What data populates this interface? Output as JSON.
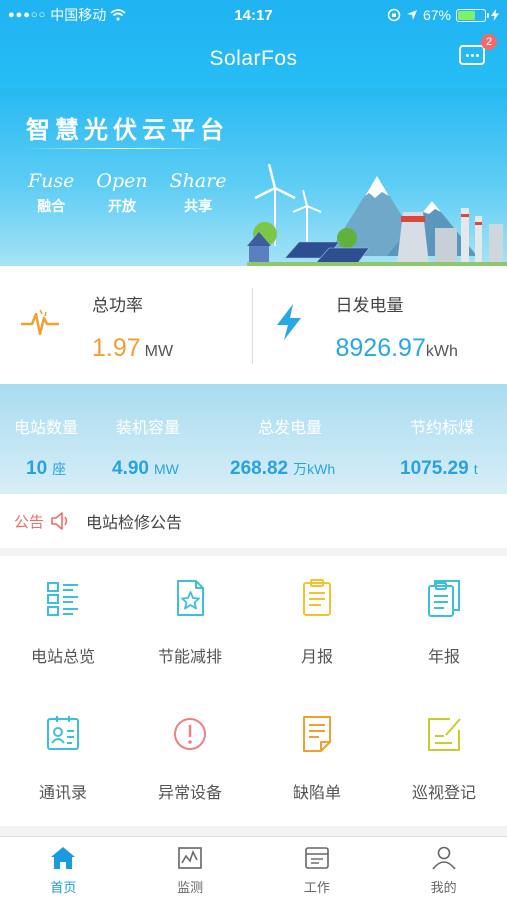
{
  "status_bar": {
    "signal": "●●●○○",
    "carrier": "中国移动",
    "time": "14:17",
    "battery": "67%",
    "battery_level": 0.67
  },
  "header": {
    "title": "SolarFos",
    "message_badge": "2"
  },
  "banner": {
    "slogan": "智慧光伏云平台",
    "words": [
      {
        "en": "Fuse",
        "cn": "融合"
      },
      {
        "en": "Open",
        "cn": "开放"
      },
      {
        "en": "Share",
        "cn": "共享"
      }
    ]
  },
  "power": {
    "total_label": "总功率",
    "total_value": "1.97",
    "total_unit": "MW",
    "daily_label": "日发电量",
    "daily_value": "8926.97",
    "daily_unit": "kWh"
  },
  "stats": [
    {
      "label": "电站数量",
      "value": "10",
      "unit": "座"
    },
    {
      "label": "装机容量",
      "value": "4.90",
      "unit": "MW"
    },
    {
      "label": "总发电量",
      "value": "268.82",
      "unit": "万kWh"
    },
    {
      "label": "节约标煤",
      "value": "1075.29",
      "unit": "t"
    }
  ],
  "notice": {
    "tag": "公告",
    "text": "电站检修公告"
  },
  "grid": [
    {
      "label": "电站总览",
      "icon": "station-overview-icon",
      "color": "#3cc0d8"
    },
    {
      "label": "节能减排",
      "icon": "energy-saving-icon",
      "color": "#3cc0d8"
    },
    {
      "label": "月报",
      "icon": "monthly-report-icon",
      "color": "#f2c230"
    },
    {
      "label": "年报",
      "icon": "annual-report-icon",
      "color": "#3cc0d8"
    },
    {
      "label": "通讯录",
      "icon": "contacts-icon",
      "color": "#3cc0d8"
    },
    {
      "label": "异常设备",
      "icon": "abnormal-device-icon",
      "color": "#f08080"
    },
    {
      "label": "缺陷单",
      "icon": "defect-list-icon",
      "color": "#f0a030"
    },
    {
      "label": "巡视登记",
      "icon": "patrol-register-icon",
      "color": "#c8cc30"
    }
  ],
  "tabs": [
    {
      "label": "首页",
      "icon": "home-icon",
      "active": true
    },
    {
      "label": "监测",
      "icon": "monitor-icon",
      "active": false
    },
    {
      "label": "工作",
      "icon": "work-icon",
      "active": false
    },
    {
      "label": "我的",
      "icon": "profile-icon",
      "active": false
    }
  ],
  "colors": {
    "accent": "#1fb3f2",
    "orange": "#f0a030",
    "blue": "#27a7e3",
    "alert": "#f06c6c"
  }
}
